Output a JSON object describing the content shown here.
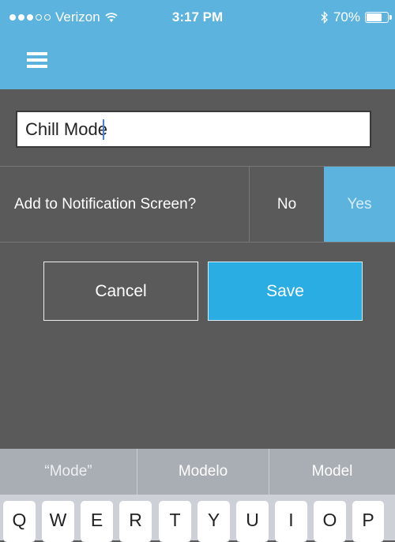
{
  "status_bar": {
    "carrier": "Verizon",
    "time": "3:17 PM",
    "battery": "70%",
    "signal_bars": 3,
    "signal_total": 5,
    "battery_level": 0.7,
    "icons": [
      "signal-dots-icon",
      "wifi-icon",
      "bluetooth-icon",
      "battery-icon"
    ]
  },
  "header": {
    "menu_icon": "hamburger-menu-icon",
    "color": "#5bb3de"
  },
  "form": {
    "name_value": "Chill Mode",
    "notification_label": "Add to Notification Screen?",
    "option_no": "No",
    "option_yes": "Yes",
    "selected_option": "Yes",
    "cancel_label": "Cancel",
    "save_label": "Save"
  },
  "keyboard": {
    "suggestions": [
      "“Mode”",
      "Modelo",
      "Model"
    ],
    "row1": [
      "Q",
      "W",
      "E",
      "R",
      "T",
      "Y",
      "U",
      "I",
      "O",
      "P"
    ]
  },
  "colors": {
    "accent": "#5bb3de",
    "save": "#2aade3",
    "background": "#5a5a5a"
  }
}
